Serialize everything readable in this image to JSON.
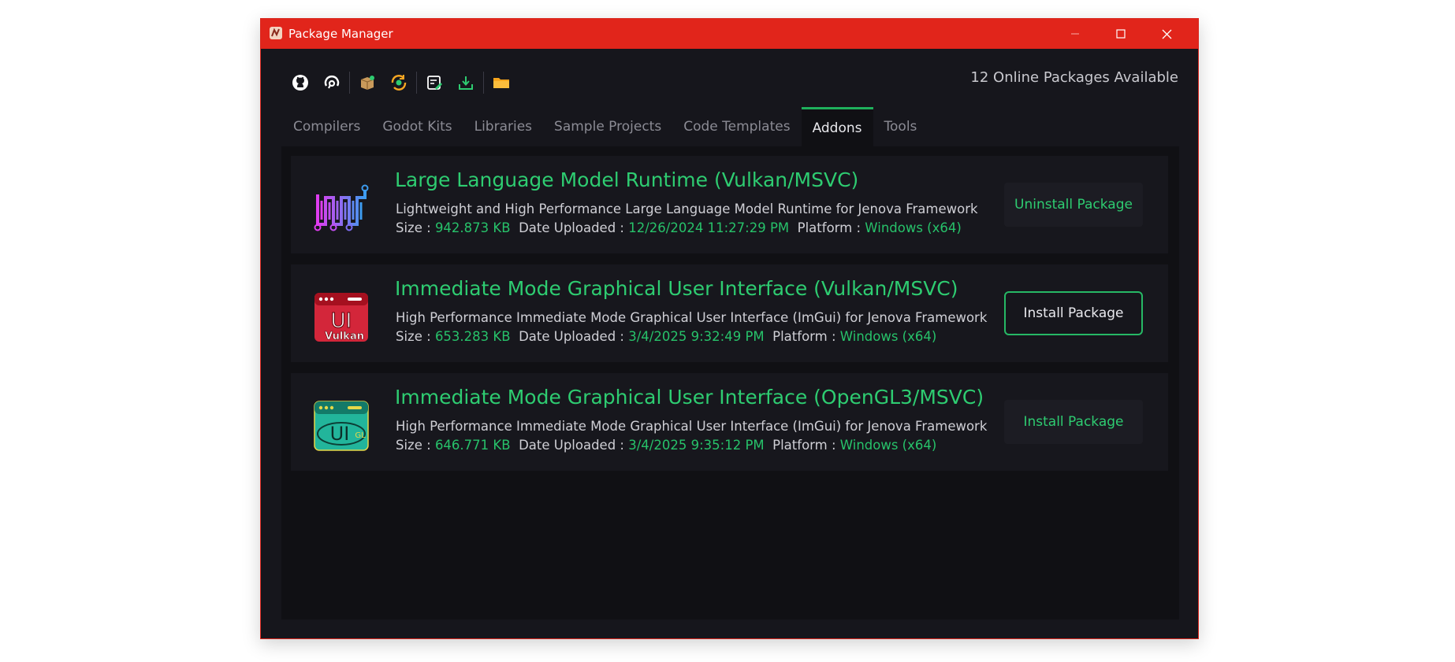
{
  "window": {
    "title": "Package Manager"
  },
  "toolbar": {
    "icons": [
      "github-icon",
      "support-icon",
      "package-icon",
      "update-icon",
      "edit-package-icon",
      "download-icon",
      "folder-icon"
    ],
    "online_count": "12 Online Packages Available"
  },
  "tabs": [
    {
      "label": "Compilers"
    },
    {
      "label": "Godot Kits"
    },
    {
      "label": "Libraries"
    },
    {
      "label": "Sample Projects"
    },
    {
      "label": "Code Templates"
    },
    {
      "label": "Addons",
      "active": true
    },
    {
      "label": "Tools"
    }
  ],
  "labels": {
    "size": "Size :",
    "date": "Date Uploaded :",
    "platform": "Platform :"
  },
  "packages": [
    {
      "icon": "llm-runtime-icon",
      "title": "Large Language Model Runtime (Vulkan/MSVC)",
      "description": "Lightweight and High Performance Large Language Model Runtime for Jenova Framework",
      "size": "942.873 KB",
      "date": "12/26/2024 11:27:29 PM",
      "platform": "Windows (x64)",
      "button": "Uninstall Package"
    },
    {
      "icon": "imgui-vulkan-icon",
      "title": "Immediate Mode Graphical User Interface (Vulkan/MSVC)",
      "description": "High Performance Immediate Mode Graphical User Interface (ImGui) for Jenova Framework",
      "size": "653.283 KB",
      "date": "3/4/2025 9:32:49 PM",
      "platform": "Windows (x64)",
      "button": "Install Package",
      "icon_text": "UI",
      "icon_sub": "Vulkan"
    },
    {
      "icon": "imgui-opengl-icon",
      "title": "Immediate Mode Graphical User Interface (OpenGL3/MSVC)",
      "description": "High Performance Immediate Mode Graphical User Interface (ImGui) for Jenova Framework",
      "size": "646.771 KB",
      "date": "3/4/2025 9:35:12 PM",
      "platform": "Windows (x64)",
      "button": "Install Package",
      "icon_text": "UI",
      "icon_sub": "GL"
    }
  ],
  "colors": {
    "titlebar": "#e1251b",
    "accent": "#2ecc71",
    "background": "#16161c"
  }
}
